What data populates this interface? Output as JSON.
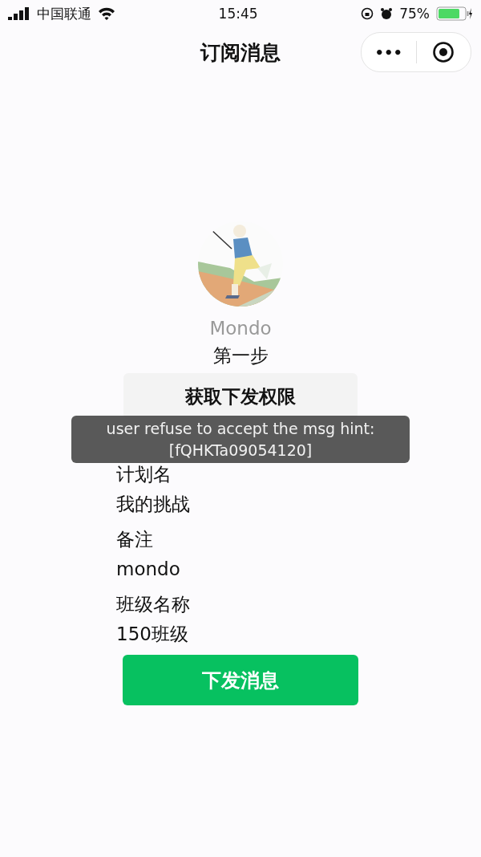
{
  "status_bar": {
    "carrier": "中国联通",
    "time": "15:45",
    "battery": "75%"
  },
  "nav": {
    "title": "订阅消息",
    "more": "•••"
  },
  "profile": {
    "name": "Mondo"
  },
  "step_one": {
    "heading": "第一步",
    "button": "获取下发权限"
  },
  "fields": [
    {
      "label": "计划名",
      "value": "我的挑战"
    },
    {
      "label": "备注",
      "value": "mondo"
    },
    {
      "label": "班级名称",
      "value": "150班级"
    }
  ],
  "send_button": "下发消息",
  "toast": {
    "lines": [
      "user refuse to accept the msg hint:",
      "[fQHKTa09054120]"
    ]
  }
}
